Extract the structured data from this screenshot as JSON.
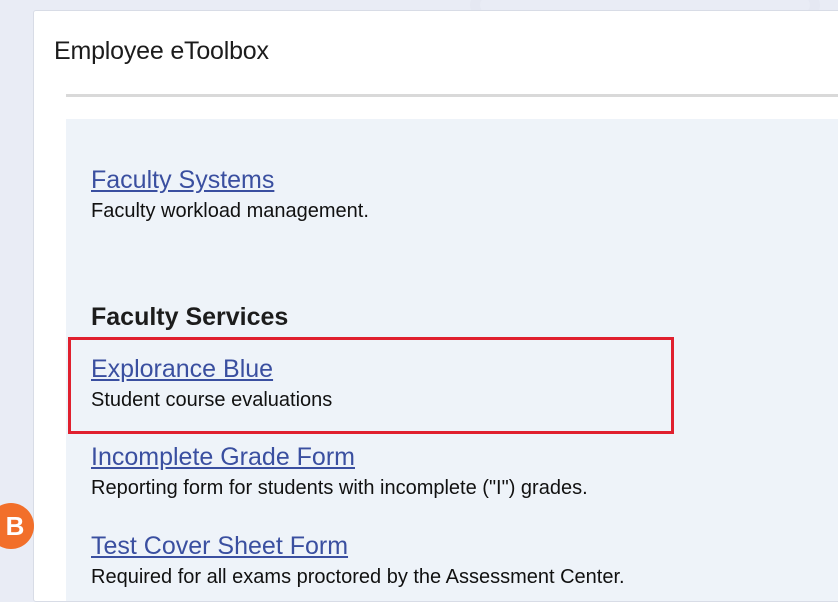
{
  "panel": {
    "title": "Employee eToolbox"
  },
  "links": {
    "faculty_systems": {
      "label": "Faculty Systems",
      "description": "Faculty workload management."
    },
    "section_heading": "Faculty Services",
    "explorance_blue": {
      "label": "Explorance Blue",
      "description": "Student course evaluations"
    },
    "incomplete_grade_form": {
      "label": "Incomplete Grade Form",
      "description": "Reporting form for students with incomplete (\"I\") grades."
    },
    "test_cover_sheet_form": {
      "label": "Test Cover Sheet Form",
      "description": "Required for all exams proctored by the Assessment Center."
    }
  },
  "annotation": {
    "step_label": "B",
    "highlight_color": "#e0202e",
    "badge_color": "#f26f2a"
  },
  "colors": {
    "link": "#3a4fa0",
    "content_background": "#eef3f9",
    "page_background": "#e9ecf5"
  }
}
